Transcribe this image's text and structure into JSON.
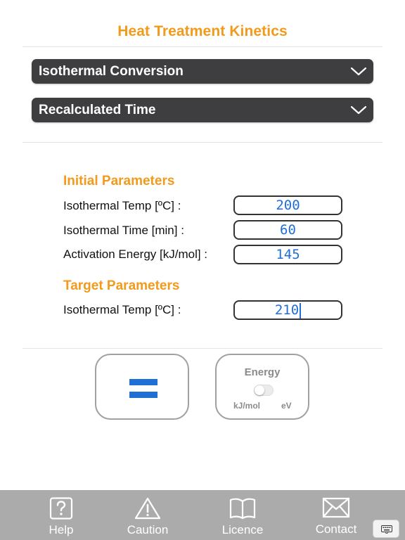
{
  "app": {
    "title": "Heat Treatment Kinetics"
  },
  "dropdowns": {
    "mode": {
      "label": "Isothermal Conversion"
    },
    "result": {
      "label": "Recalculated Time"
    }
  },
  "initial": {
    "title": "Initial Parameters",
    "temp_label": "Isothermal Temp [ºC] :",
    "temp_value": "200",
    "time_label": "Isothermal Time [min] :",
    "time_value": "60",
    "energy_label": "Activation Energy [kJ/mol] :",
    "energy_value": "145"
  },
  "target": {
    "title": "Target Parameters",
    "temp_label": "Isothermal Temp [ºC] :",
    "temp_value": "210"
  },
  "energy_toggle": {
    "title": "Energy",
    "left_unit": "kJ/mol",
    "right_unit": "eV",
    "on": false
  },
  "tabs": [
    {
      "label": "Help",
      "icon": "question-box-icon"
    },
    {
      "label": "Caution",
      "icon": "warning-triangle-icon"
    },
    {
      "label": "Licence",
      "icon": "open-book-icon"
    },
    {
      "label": "Contact",
      "icon": "envelope-icon"
    }
  ],
  "colors": {
    "accent": "#f29a1c",
    "input_text": "#1f6fd6",
    "dropdown_bg": "#3e3e40",
    "tabbar_bg": "#ababab"
  }
}
